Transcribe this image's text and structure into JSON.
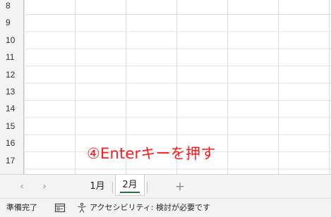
{
  "rows": [
    "8",
    "9",
    "10",
    "11",
    "12",
    "13",
    "14",
    "15",
    "16",
    "17"
  ],
  "annotation": "④Enterキーを押す",
  "sheet_tabs": [
    {
      "label": "1月",
      "active": false
    },
    {
      "label": "2月",
      "active": true
    }
  ],
  "tabbar": {
    "prev_icon": "‹",
    "next_icon": "›",
    "add_icon": "+"
  },
  "status": {
    "ready": "準備完了",
    "accessibility": "アクセシビリティ: 検討が必要です"
  },
  "colors": {
    "accent": "#217346",
    "annotation": "#ff1a1a"
  }
}
